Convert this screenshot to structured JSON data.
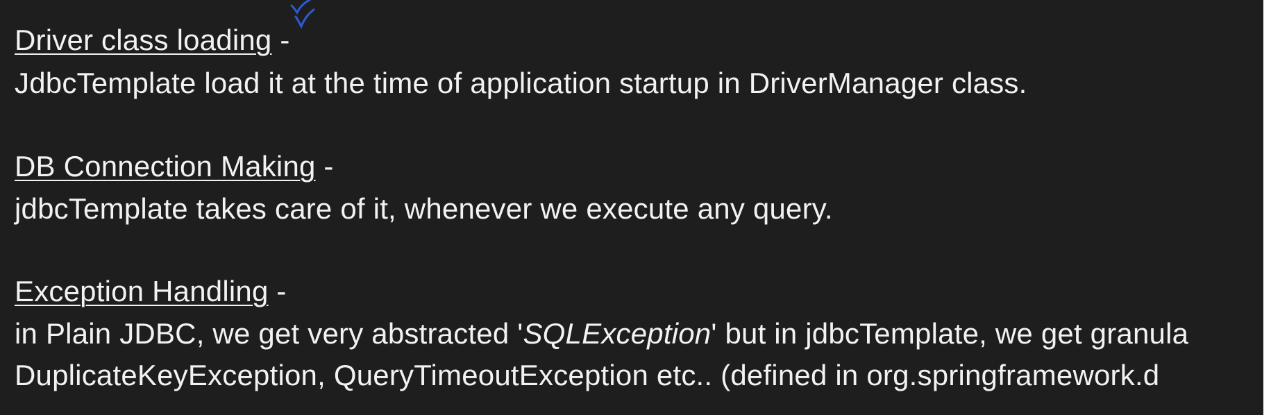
{
  "sections": [
    {
      "heading": "Driver class loading",
      "separator": "  -",
      "text": "JdbcTemplate load it at the time of application startup in DriverManager class."
    },
    {
      "heading": "DB Connection Making",
      "separator": " -",
      "text": "jdbcTemplate takes care of it, whenever we execute any query."
    },
    {
      "heading": "Exception Handling",
      "separator": " -",
      "text_before_italic": "in Plain JDBC, we get very abstracted '",
      "text_italic": "SQLException",
      "text_after_italic": "' but in jdbcTemplate, we get granula",
      "text_line2": "DuplicateKeyException, QueryTimeoutException etc.. (defined in org.springframework.d"
    }
  ],
  "annotation": {
    "icon": "handwritten-checkmark-icon",
    "color": "#2b5bd7"
  }
}
